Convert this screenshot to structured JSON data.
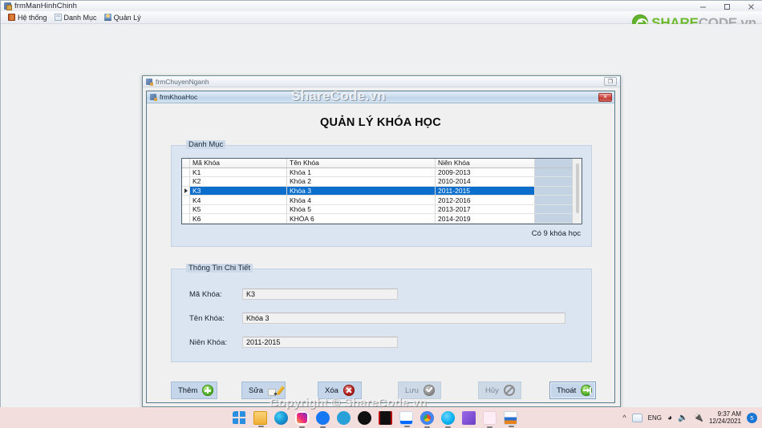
{
  "os_window": {
    "title": "frmManHinhChinh",
    "controls": {
      "minimize": "minimize-icon",
      "maximize": "maximize-icon",
      "close": "close-icon"
    }
  },
  "menubar": {
    "items": [
      {
        "label": "Hệ thống",
        "icon": "book-icon"
      },
      {
        "label": "Danh Mục",
        "icon": "document-icon"
      },
      {
        "label": "Quản Lý",
        "icon": "user-icon"
      }
    ]
  },
  "brand": {
    "part_green": "SHARE",
    "part_grey": "CODE.vn",
    "logo_icon": "sharecode-recycle-logo",
    "green": "#6cb92d",
    "grey": "#a9a9a9"
  },
  "watermarks": {
    "titlebar": "ShareCode.vn",
    "bottom": "Copyright © ShareCode.vn"
  },
  "mdi_child_back": {
    "title": "frmChuyenNganh",
    "maximize_label": "❐"
  },
  "mdi_child_front": {
    "title": "frmKhoaHoc",
    "close_label": "✕",
    "heading": "QUẢN LÝ KHÓA HỌC"
  },
  "group_list": {
    "caption": "Danh Mục",
    "count_text": "Có 9 khóa học",
    "grid": {
      "columns": [
        "Mã Khóa",
        "Tên Khóa",
        "Niên Khóa"
      ],
      "rows": [
        {
          "ma": "K1",
          "ten": "Khóa 1",
          "nien": "2009-2013",
          "selected": false
        },
        {
          "ma": "K2",
          "ten": "Khóa 2",
          "nien": "2010-2014",
          "selected": false
        },
        {
          "ma": "K3",
          "ten": "Khóa 3",
          "nien": "2011-2015",
          "selected": true
        },
        {
          "ma": "K4",
          "ten": "Khóa 4",
          "nien": "2012-2016",
          "selected": false
        },
        {
          "ma": "K5",
          "ten": "Khóa 5",
          "nien": "2013-2017",
          "selected": false
        },
        {
          "ma": "K6",
          "ten": "KHÓA 6",
          "nien": "2014-2019",
          "selected": false
        }
      ],
      "selection_color": "#0a6ecd"
    }
  },
  "group_detail": {
    "caption": "Thông Tin Chi Tiết",
    "fields": [
      {
        "label": "Mã Khóa:",
        "value": "K3"
      },
      {
        "label": "Tên Khóa:",
        "value": "Khóa 3"
      },
      {
        "label": "Niên Khóa:",
        "value": "2011-2015"
      }
    ]
  },
  "buttons": [
    {
      "label": "Thêm",
      "icon": "plus-circle-icon",
      "enabled": true,
      "focused": false
    },
    {
      "label": "Sửa",
      "icon": "pencil-edit-icon",
      "enabled": true,
      "focused": false
    },
    {
      "label": "Xóa",
      "icon": "delete-x-icon",
      "enabled": true,
      "focused": false
    },
    {
      "label": "Lưu",
      "icon": "check-circle-icon",
      "enabled": false,
      "focused": false
    },
    {
      "label": "Hủy",
      "icon": "ban-circle-icon",
      "enabled": false,
      "focused": false
    },
    {
      "label": "Thoát",
      "icon": "exit-door-icon",
      "enabled": true,
      "focused": true
    }
  ],
  "taskbar": {
    "apps": [
      {
        "name": "start-icon",
        "color": "#2a8fe0"
      },
      {
        "name": "file-explorer-icon",
        "color": "#f2b431"
      },
      {
        "name": "edge-icon",
        "color": "#1a9ad7"
      },
      {
        "name": "instagram-icon",
        "color": "#d82c7e"
      },
      {
        "name": "facebook-icon",
        "color": "#1877f2"
      },
      {
        "name": "telegram-icon",
        "color": "#2aa0d8"
      },
      {
        "name": "tiktok-icon",
        "color": "#101010"
      },
      {
        "name": "netflix-icon",
        "color": "#b9090b"
      },
      {
        "name": "zalo-icon",
        "color": "#0068ff"
      },
      {
        "name": "chrome-icon",
        "color": "#4285f4"
      },
      {
        "name": "skype-icon",
        "color": "#00aff0"
      },
      {
        "name": "vscode-icon",
        "color": "#7f4bd8"
      },
      {
        "name": "visualstudio-icon",
        "color": "#68217a"
      },
      {
        "name": "app-window-icon",
        "color": "#e8821b"
      }
    ],
    "language": "ENG",
    "time": "9:37 AM",
    "date": "12/24/2021",
    "notification_count": "5"
  }
}
